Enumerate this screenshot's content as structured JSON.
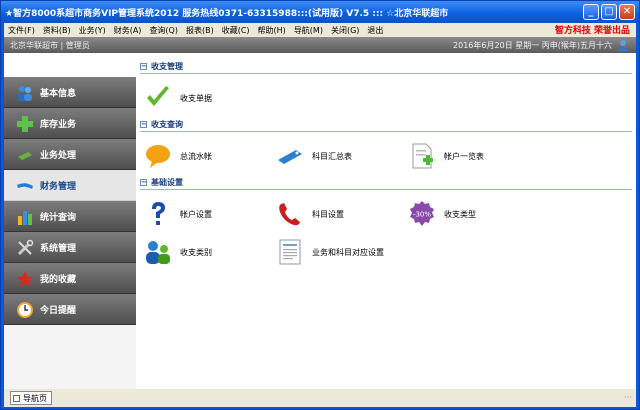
{
  "window": {
    "title": "★智方8000系超市商务VIP管理系统2012 服务热线0371-63315988:::(试用版) V7.5 ::: ☆北京华联超市",
    "minimize": "_",
    "restore": "□",
    "close": "✕"
  },
  "menu": {
    "items": [
      "文件(F)",
      "资料(B)",
      "业务(Y)",
      "财务(A)",
      "查询(Q)",
      "报表(B)",
      "收藏(C)",
      "帮助(H)",
      "导航(M)",
      "关闭(G)",
      "退出"
    ],
    "brand": "智方科技 荣誉出品"
  },
  "info": {
    "left": "北京华联超市 | 管理员",
    "right": "2016年6月20日 星期一 丙申(猴年)五月十六"
  },
  "sidebar": {
    "items": [
      {
        "label": "基本信息",
        "icon": "users-icon"
      },
      {
        "label": "库存业务",
        "icon": "plus-icon"
      },
      {
        "label": "业务处理",
        "icon": "card-icon"
      },
      {
        "label": "财务管理",
        "icon": "finance-icon",
        "active": true
      },
      {
        "label": "统计查询",
        "icon": "chart-icon"
      },
      {
        "label": "系统管理",
        "icon": "tools-icon"
      },
      {
        "label": "我的收藏",
        "icon": "star-icon"
      },
      {
        "label": "今日提醒",
        "icon": "clock-icon"
      }
    ]
  },
  "main": {
    "sections": [
      {
        "title": "收支管理",
        "items": [
          {
            "label": "收支单据",
            "icon": "check-icon"
          }
        ]
      },
      {
        "title": "收支查询",
        "items": [
          {
            "label": "总流水帐",
            "icon": "speech-bubble-icon"
          },
          {
            "label": "科目汇总表",
            "icon": "tag-icon"
          },
          {
            "label": "帐户一览表",
            "icon": "document-add-icon"
          }
        ]
      },
      {
        "title": "基础设置",
        "items": [
          {
            "label": "帐户设置",
            "icon": "question-icon"
          },
          {
            "label": "科目设置",
            "icon": "phone-icon"
          },
          {
            "label": "收支类型",
            "icon": "discount-badge-icon"
          },
          {
            "label": "收支类别",
            "icon": "group-icon"
          },
          {
            "label": "业务和科目对应设置",
            "icon": "form-icon"
          }
        ]
      }
    ],
    "discount_badge_text": "-30%"
  },
  "status": {
    "tab_label": "导航页",
    "grip": "···"
  }
}
